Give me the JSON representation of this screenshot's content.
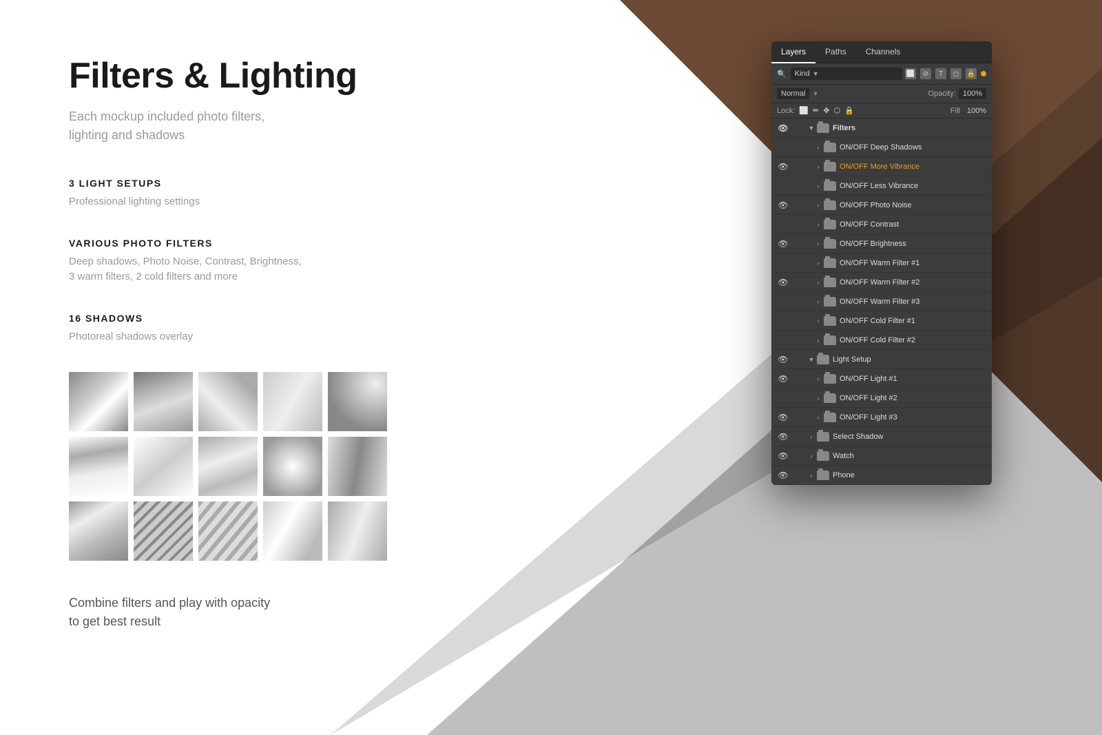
{
  "background": {
    "triangle_color": "#6b4a35"
  },
  "content": {
    "title": "Filters & Lighting",
    "subtitle": "Each mockup included photo filters,\nlighting and shadows",
    "sections": [
      {
        "heading": "3 LIGHT SETUPS",
        "text": "Professional lighting settings"
      },
      {
        "heading": "VARIOUS PHOTO FILTERS",
        "text": "Deep shadows, Photo Noise, Contrast, Brightness,\n3 warm filters, 2 cold filters and more"
      },
      {
        "heading": "16 SHADOWS",
        "text": "Photoreal shadows overlay"
      }
    ],
    "combine_text": "Combine filters and play with opacity\nto get best result"
  },
  "ps_panel": {
    "tabs": [
      "Layers",
      "Paths",
      "Channels"
    ],
    "active_tab": "Layers",
    "kind_label": "Kind",
    "normal_label": "Normal",
    "opacity_label": "Opacity:",
    "lock_label": "Lock:",
    "fill_label": "Fill",
    "layers": [
      {
        "id": "filters-group",
        "name": "Filters",
        "type": "group",
        "visible": true,
        "indent": 0
      },
      {
        "id": "deep-shadows",
        "name": "ON/OFF Deep Shadows",
        "type": "folder",
        "visible": false,
        "indent": 1
      },
      {
        "id": "more-vibrance",
        "name": "ON/OFF More Vibrance",
        "type": "folder",
        "visible": true,
        "indent": 1,
        "highlight": true
      },
      {
        "id": "less-vibrance",
        "name": "ON/OFF Less Vibrance",
        "type": "folder",
        "visible": false,
        "indent": 1
      },
      {
        "id": "photo-noise",
        "name": "ON/OFF Photo Noise",
        "type": "folder",
        "visible": true,
        "indent": 1
      },
      {
        "id": "contrast",
        "name": "ON/OFF Contrast",
        "type": "folder",
        "visible": false,
        "indent": 1
      },
      {
        "id": "brightness",
        "name": "ON/OFF Brightness",
        "type": "folder",
        "visible": true,
        "indent": 1
      },
      {
        "id": "warm-filter-1",
        "name": "ON/OFF Warm Filter #1",
        "type": "folder",
        "visible": false,
        "indent": 1
      },
      {
        "id": "warm-filter-2",
        "name": "ON/OFF Warm Filter #2",
        "type": "folder",
        "visible": true,
        "indent": 1
      },
      {
        "id": "warm-filter-3",
        "name": "ON/OFF Warm Filter #3",
        "type": "folder",
        "visible": false,
        "indent": 1
      },
      {
        "id": "cold-filter-1",
        "name": "ON/OFF Cold Filter #1",
        "type": "folder",
        "visible": false,
        "indent": 1
      },
      {
        "id": "cold-filter-2",
        "name": "ON/OFF Cold Filter #2",
        "type": "folder",
        "visible": false,
        "indent": 1
      },
      {
        "id": "light-setup-group",
        "name": "Light Setup",
        "type": "group",
        "visible": true,
        "indent": 0
      },
      {
        "id": "light-1",
        "name": "ON/OFF Light #1",
        "type": "folder",
        "visible": true,
        "indent": 1
      },
      {
        "id": "light-2",
        "name": "ON/OFF Light #2",
        "type": "folder",
        "visible": false,
        "indent": 1
      },
      {
        "id": "light-3",
        "name": "ON/OFF Light #3",
        "type": "folder",
        "visible": true,
        "indent": 1
      },
      {
        "id": "select-shadow",
        "name": "Select Shadow",
        "type": "group",
        "visible": true,
        "indent": 0
      },
      {
        "id": "watch",
        "name": "Watch",
        "type": "group-expand",
        "visible": true,
        "indent": 0
      },
      {
        "id": "phone",
        "name": "Phone",
        "type": "group-expand",
        "visible": true,
        "indent": 0
      }
    ]
  }
}
